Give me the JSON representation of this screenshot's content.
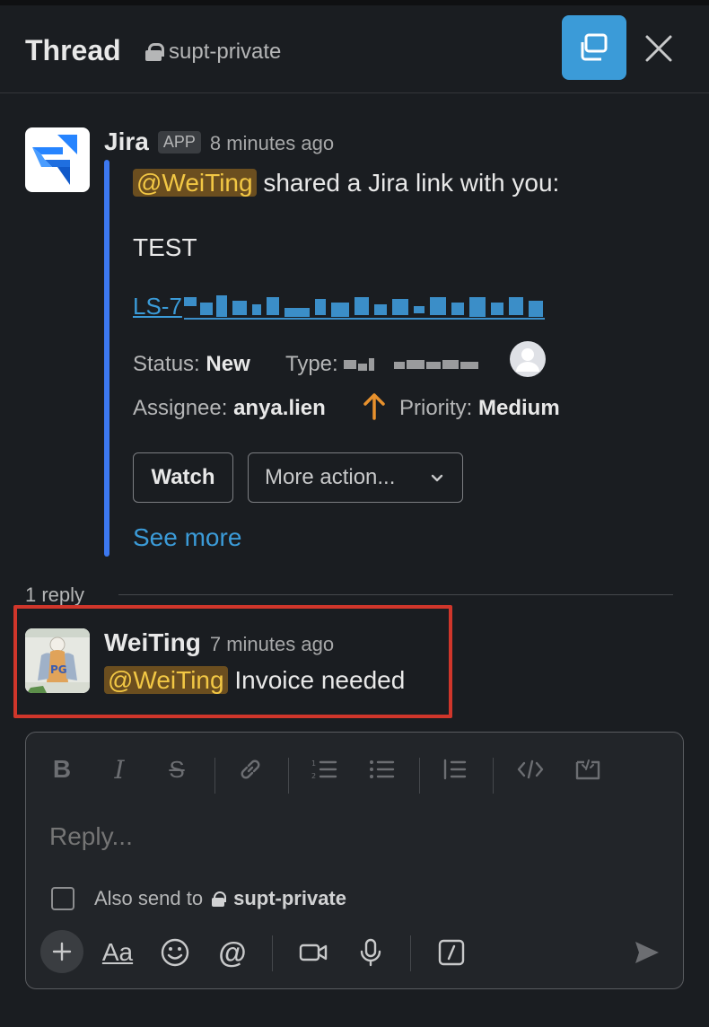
{
  "header": {
    "title": "Thread",
    "channel": "supt-private"
  },
  "parent_message": {
    "sender": "Jira",
    "badge": "APP",
    "time": "8 minutes ago",
    "mention": "@WeiTing",
    "shared_text": "shared a Jira link with you:",
    "issue_title": "TEST",
    "issue_key_prefix": "LS-7",
    "status_label": "Status:",
    "status_value": "New",
    "type_label": "Type:",
    "assignee_label": "Assignee:",
    "assignee_value": "anya.lien",
    "priority_label": "Priority:",
    "priority_value": "Medium",
    "watch_button": "Watch",
    "more_actions": "More action...",
    "see_more": "See more"
  },
  "replies": {
    "count_label": "1 reply",
    "items": [
      {
        "sender": "WeiTing",
        "time": "7 minutes ago",
        "mention": "@WeiTing",
        "text": "Invoice needed"
      }
    ]
  },
  "composer": {
    "placeholder": "Reply...",
    "also_send_label": "Also send to",
    "also_send_channel": "supt-private"
  },
  "colors": {
    "accent_blue": "#3b9bd8",
    "quote_bar": "#3c78f0",
    "mention_bg": "#6b4e1f",
    "mention_fg": "#f2c744",
    "highlight": "#d0362b",
    "priority_arrow": "#e8912d"
  }
}
